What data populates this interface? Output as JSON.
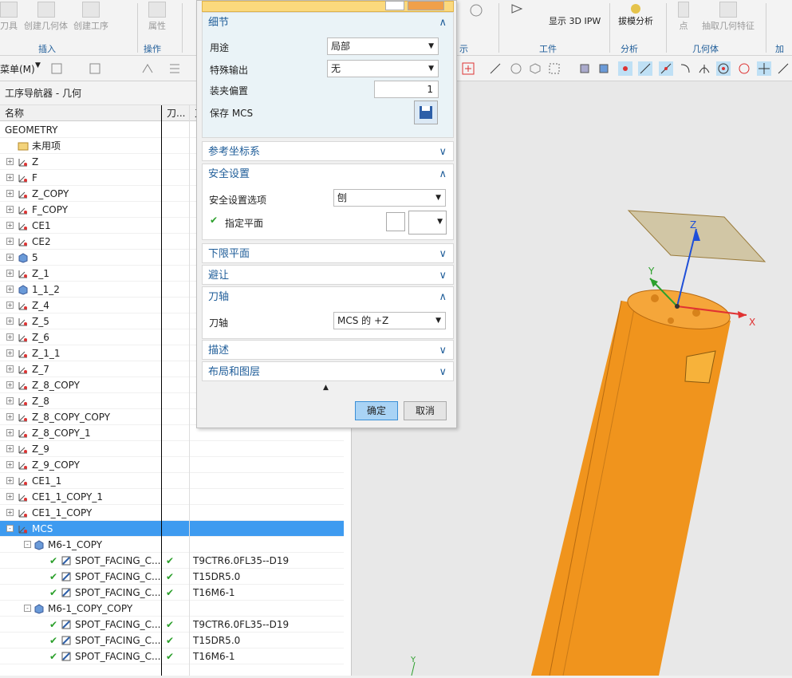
{
  "ribbon": {
    "buttons_left": [
      "刀具",
      "创建几何体",
      "创建工序",
      "属性"
    ],
    "groups": {
      "insert": "插入",
      "operation": "操作",
      "workpiece": "工件",
      "analysis": "分析",
      "geometry": "几何体",
      "machining": "加工",
      "display": "示"
    },
    "show_3d_ipw": "显示 3D IPW",
    "draft_analysis": "拔模分析",
    "point": "点",
    "extract_geometry": "抽取几何特征"
  },
  "toolbar": {
    "menu_label": "菜单(M)"
  },
  "navigator": {
    "title": "工序导航器 - 几何",
    "columns": [
      "名称",
      "刀...",
      "刀"
    ],
    "rows": [
      {
        "name": "GEOMETRY",
        "level": 0,
        "icon": "none"
      },
      {
        "name": "未用项",
        "level": 1,
        "icon": "folder-icon"
      },
      {
        "name": "Z",
        "level": 1,
        "icon": "mcs-icon",
        "exp": "+"
      },
      {
        "name": "F",
        "level": 1,
        "icon": "mcs-icon",
        "exp": "+"
      },
      {
        "name": "Z_COPY",
        "level": 1,
        "icon": "mcs-icon",
        "exp": "+"
      },
      {
        "name": "F_COPY",
        "level": 1,
        "icon": "mcs-icon",
        "exp": "+"
      },
      {
        "name": "CE1",
        "level": 1,
        "icon": "mcs-icon",
        "exp": "+"
      },
      {
        "name": "CE2",
        "level": 1,
        "icon": "mcs-icon",
        "exp": "+"
      },
      {
        "name": "5",
        "level": 1,
        "icon": "workpiece-icon",
        "exp": "+"
      },
      {
        "name": "Z_1",
        "level": 1,
        "icon": "mcs-icon",
        "exp": "+"
      },
      {
        "name": "1_1_2",
        "level": 1,
        "icon": "workpiece-icon",
        "exp": "+"
      },
      {
        "name": "Z_4",
        "level": 1,
        "icon": "mcs-icon",
        "exp": "+"
      },
      {
        "name": "Z_5",
        "level": 1,
        "icon": "mcs-icon",
        "exp": "+"
      },
      {
        "name": "Z_6",
        "level": 1,
        "icon": "mcs-icon",
        "exp": "+"
      },
      {
        "name": "Z_1_1",
        "level": 1,
        "icon": "mcs-icon",
        "exp": "+"
      },
      {
        "name": "Z_7",
        "level": 1,
        "icon": "mcs-icon",
        "exp": "+"
      },
      {
        "name": "Z_8_COPY",
        "level": 1,
        "icon": "mcs-icon",
        "exp": "+"
      },
      {
        "name": "Z_8",
        "level": 1,
        "icon": "mcs-icon",
        "exp": "+"
      },
      {
        "name": "Z_8_COPY_COPY",
        "level": 1,
        "icon": "mcs-icon",
        "exp": "+"
      },
      {
        "name": "Z_8_COPY_1",
        "level": 1,
        "icon": "mcs-icon",
        "exp": "+"
      },
      {
        "name": "Z_9",
        "level": 1,
        "icon": "mcs-icon",
        "exp": "+"
      },
      {
        "name": "Z_9_COPY",
        "level": 1,
        "icon": "mcs-icon",
        "exp": "+"
      },
      {
        "name": "CE1_1",
        "level": 1,
        "icon": "mcs-icon",
        "exp": "+"
      },
      {
        "name": "CE1_1_COPY_1",
        "level": 1,
        "icon": "mcs-icon",
        "exp": "+"
      },
      {
        "name": "CE1_1_COPY",
        "level": 1,
        "icon": "mcs-icon",
        "exp": "+"
      },
      {
        "name": "MCS",
        "level": 1,
        "icon": "mcs-icon",
        "exp": "-",
        "selected": true
      },
      {
        "name": "M6-1_COPY",
        "level": 2,
        "icon": "workpiece-icon",
        "exp": "-"
      },
      {
        "name": "SPOT_FACING_C...",
        "level": 3,
        "icon": "operation-icon",
        "check": true,
        "tool": "T9CTR6.0FL35--D19"
      },
      {
        "name": "SPOT_FACING_C...",
        "level": 3,
        "icon": "operation-icon",
        "check": true,
        "tool": "T15DR5.0"
      },
      {
        "name": "SPOT_FACING_C...",
        "level": 3,
        "icon": "operation-icon",
        "check": true,
        "tool": "T16M6-1"
      },
      {
        "name": "M6-1_COPY_COPY",
        "level": 2,
        "icon": "workpiece-icon",
        "exp": "-"
      },
      {
        "name": "SPOT_FACING_C...",
        "level": 3,
        "icon": "operation-icon",
        "check": true,
        "tool": "T9CTR6.0FL35--D19"
      },
      {
        "name": "SPOT_FACING_C...",
        "level": 3,
        "icon": "operation-icon",
        "check": true,
        "tool": "T15DR5.0"
      },
      {
        "name": "SPOT_FACING_C...",
        "level": 3,
        "icon": "operation-icon",
        "check": true,
        "tool": "T16M6-1"
      }
    ]
  },
  "dialog": {
    "details": {
      "title": "细节",
      "purpose_label": "用途",
      "purpose_value": "局部",
      "special_output_label": "特殊输出",
      "special_output_value": "无",
      "fixture_offset_label": "装夹偏置",
      "fixture_offset_value": "1",
      "save_mcs_label": "保存 MCS"
    },
    "ref_csys": "参考坐标系",
    "safety": {
      "title": "安全设置",
      "option_label": "安全设置选项",
      "option_value": "刨",
      "plane_label": "指定平面"
    },
    "lower_plane": "下限平面",
    "avoidance": "避让",
    "tool_axis": {
      "title": "刀轴",
      "label": "刀轴",
      "value": "MCS 的 +Z"
    },
    "description": "描述",
    "layout": "布局和图层",
    "ok": "确定",
    "cancel": "取消"
  },
  "viewport": {
    "axis_x": "X",
    "axis_y": "Y",
    "axis_z": "Z"
  },
  "colors": {
    "accent": "#3e9bf0",
    "cylinder": "#f0941d",
    "check": "#2ca02c"
  }
}
